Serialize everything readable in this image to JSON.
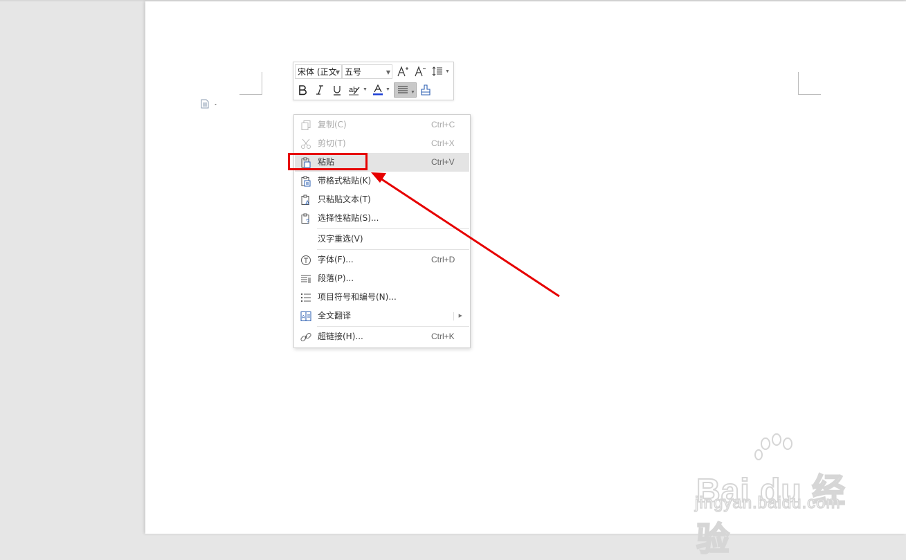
{
  "minibar": {
    "font_name": "宋体 (正文",
    "font_size": "五号"
  },
  "context_menu": {
    "items": [
      {
        "label": "复制(C)",
        "shortcut": "Ctrl+C"
      },
      {
        "label": "剪切(T)",
        "shortcut": "Ctrl+X"
      },
      {
        "label": "粘贴",
        "shortcut": "Ctrl+V"
      },
      {
        "label": "带格式粘贴(K)",
        "shortcut": ""
      },
      {
        "label": "只粘贴文本(T)",
        "shortcut": ""
      },
      {
        "label": "选择性粘贴(S)...",
        "shortcut": ""
      },
      {
        "label": "汉字重选(V)",
        "shortcut": ""
      },
      {
        "label": "字体(F)...",
        "shortcut": "Ctrl+D"
      },
      {
        "label": "段落(P)...",
        "shortcut": ""
      },
      {
        "label": "项目符号和编号(N)...",
        "shortcut": ""
      },
      {
        "label": "全文翻译",
        "shortcut": ""
      },
      {
        "label": "超链接(H)...",
        "shortcut": "Ctrl+K"
      }
    ]
  },
  "watermark": {
    "brand": "Bai du 经验",
    "url": "jingyan.baidu.com"
  },
  "colors": {
    "highlight": "#e60000",
    "font_color_bar": "#1d3fd6",
    "menu_hover": "#e4e4e4"
  }
}
